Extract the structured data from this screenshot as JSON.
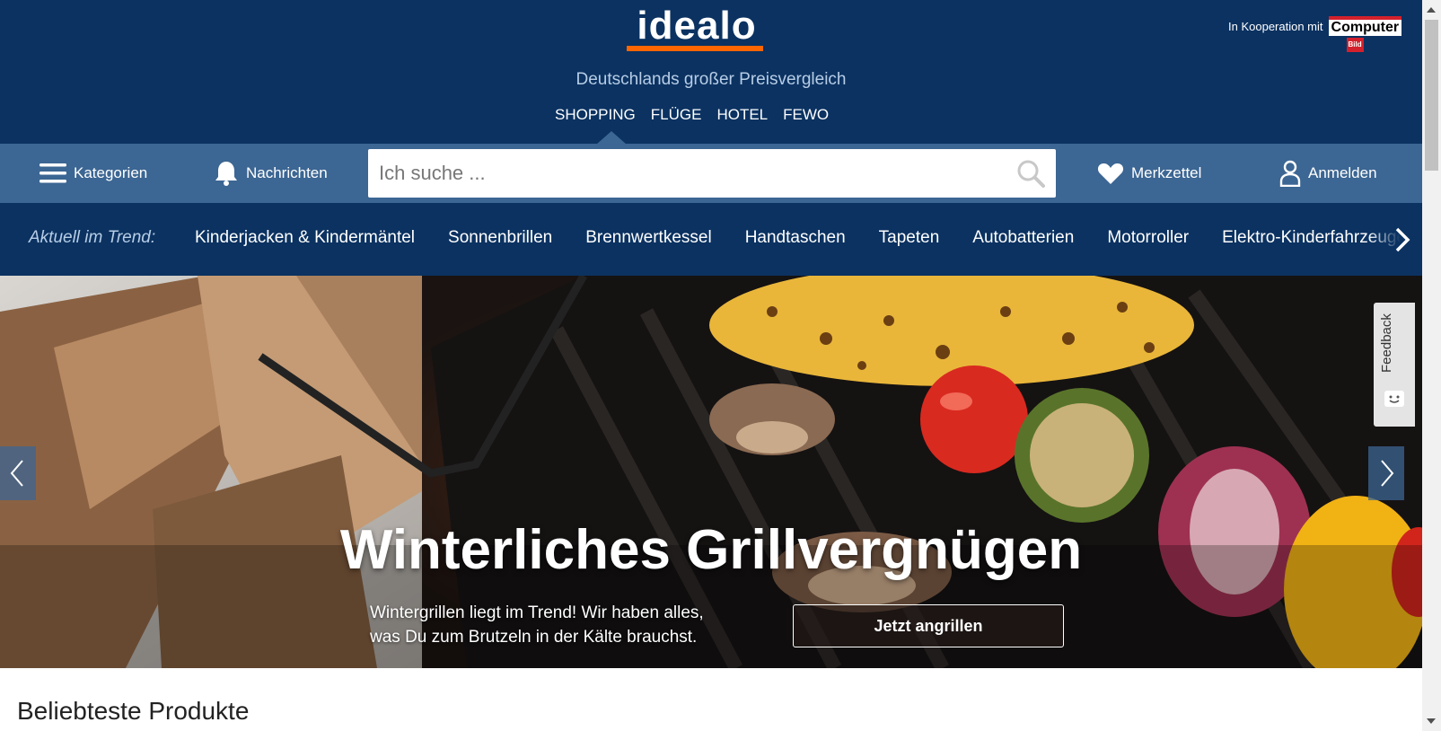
{
  "header": {
    "logo_text": "idealo",
    "tagline": "Deutschlands großer Preisvergleich",
    "nav": [
      "SHOPPING",
      "FLÜGE",
      "HOTEL",
      "FEWO"
    ],
    "cooperation_text": "In Kooperation mit",
    "partner_logo_text": "Computer",
    "partner_logo_subtext": "Bild"
  },
  "toolbar": {
    "categories_label": "Kategorien",
    "notifications_label": "Nachrichten",
    "search_placeholder": "Ich suche ...",
    "wishlist_label": "Merkzettel",
    "login_label": "Anmelden"
  },
  "trend": {
    "label": "Aktuell im Trend:",
    "items": [
      "Kinderjacken & Kindermäntel",
      "Sonnenbrillen",
      "Brennwertkessel",
      "Handtaschen",
      "Tapeten",
      "Autobatterien",
      "Motorroller",
      "Elektro-Kinderfahrzeuge"
    ]
  },
  "hero": {
    "title": "Winterliches Grillvergnügen",
    "subtitle_line1": "Wintergrillen liegt im Trend! Wir haben alles,",
    "subtitle_line2": "was Du zum Brutzeln in der Kälte brauchst.",
    "cta_label": "Jetzt angrillen"
  },
  "feedback": {
    "label": "Feedback"
  },
  "section": {
    "title": "Beliebteste Produkte"
  },
  "colors": {
    "header_bg": "#0b3261",
    "toolbar_bg": "#3c6693",
    "logo_accent": "#ff6600"
  },
  "icons": [
    "menu-icon",
    "bell-icon",
    "search-icon",
    "heart-icon",
    "user-icon",
    "chevron-right-icon",
    "chevron-left-icon",
    "smiley-icon"
  ]
}
